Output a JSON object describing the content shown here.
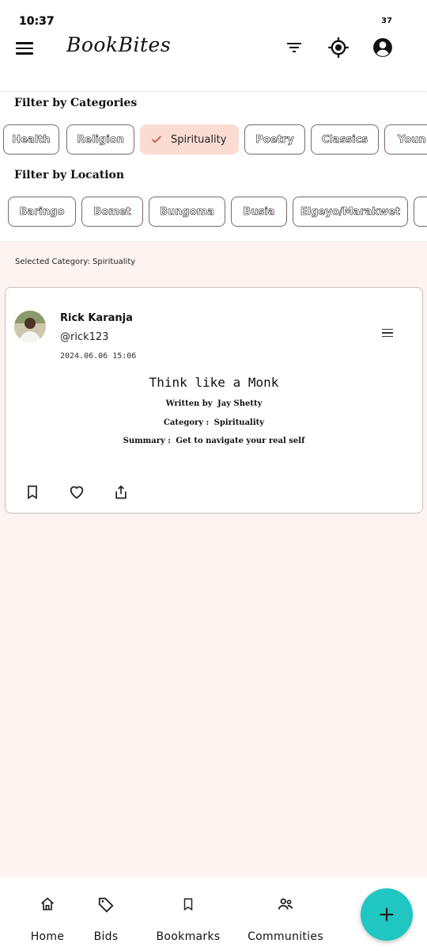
{
  "status": {
    "time": "10:37",
    "battery": "37"
  },
  "app": {
    "title": "BookBites"
  },
  "filters": {
    "categories_title": "Filter by Categories",
    "categories": [
      "Health",
      "Religion",
      "Spirituality",
      "Poetry",
      "Classics",
      "Youn"
    ],
    "selected_category_index": 2,
    "location_title": "Filter by Location",
    "locations": [
      "Baringo",
      "Bomet",
      "Bungoma",
      "Busia",
      "Elgeyo/Marakwet",
      ""
    ]
  },
  "content": {
    "selected_category_text": "Selected Category: Spirituality"
  },
  "post": {
    "author_name": "Rick Karanja",
    "author_handle": "@rick123",
    "date": "2024.06.06 15:06",
    "book_title": "Think like a Monk",
    "written_by_label": "Written by",
    "written_by_value": "Jay Shetty",
    "category_label": "Category :",
    "category_value": "Spirituality",
    "summary_label": "Summary :",
    "summary_value": "Get to navigate your real self"
  },
  "nav": {
    "items": [
      {
        "label": "Home",
        "icon": "home-icon"
      },
      {
        "label": "Bids",
        "icon": "tag-icon"
      },
      {
        "label": "Bookmarks",
        "icon": "bookmark-icon"
      },
      {
        "label": "Communities",
        "icon": "people-icon"
      }
    ],
    "fab_icon": "plus-icon"
  },
  "colors": {
    "accent": "#1fc6c2",
    "selected_chip": "#fbdcd2",
    "content_bg": "#fdf3f1"
  }
}
